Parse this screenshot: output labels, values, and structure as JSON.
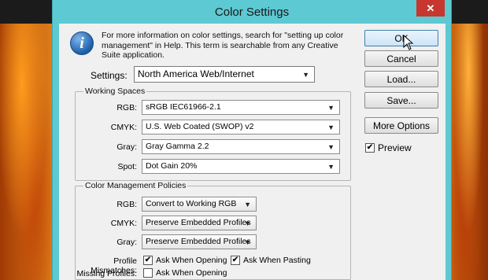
{
  "window": {
    "title": "Color Settings",
    "close_icon": "close-icon"
  },
  "info": {
    "text": "For more information on color settings, search for \"setting up color management\" in Help. This term is searchable from any Creative Suite application."
  },
  "settings": {
    "label": "Settings:",
    "value": "North America Web/Internet"
  },
  "working_spaces": {
    "legend": "Working Spaces",
    "rows": [
      {
        "label": "RGB:",
        "value": "sRGB IEC61966-2.1"
      },
      {
        "label": "CMYK:",
        "value": "U.S. Web Coated (SWOP) v2"
      },
      {
        "label": "Gray:",
        "value": "Gray Gamma 2.2"
      },
      {
        "label": "Spot:",
        "value": "Dot Gain 20%"
      }
    ]
  },
  "policies": {
    "legend": "Color Management Policies",
    "rows": [
      {
        "label": "RGB:",
        "value": "Convert to Working RGB"
      },
      {
        "label": "CMYK:",
        "value": "Preserve Embedded Profiles"
      },
      {
        "label": "Gray:",
        "value": "Preserve Embedded Profiles"
      }
    ],
    "profile_mismatches": {
      "label": "Profile Mismatches:",
      "ask_opening": {
        "label": "Ask When Opening",
        "checked": true
      },
      "ask_pasting": {
        "label": "Ask When Pasting",
        "checked": true
      }
    },
    "missing_profiles": {
      "label": "Missing Profiles:",
      "ask_opening": {
        "label": "Ask When Opening",
        "checked": false
      }
    }
  },
  "buttons": {
    "ok": "OK",
    "cancel": "Cancel",
    "load": "Load...",
    "save": "Save...",
    "more_options": "More Options"
  },
  "preview": {
    "label": "Preview",
    "checked": true
  },
  "colors": {
    "titlebar": "#5dc9d2",
    "close": "#c7372f",
    "dialog_bg": "#f0f0f0"
  }
}
